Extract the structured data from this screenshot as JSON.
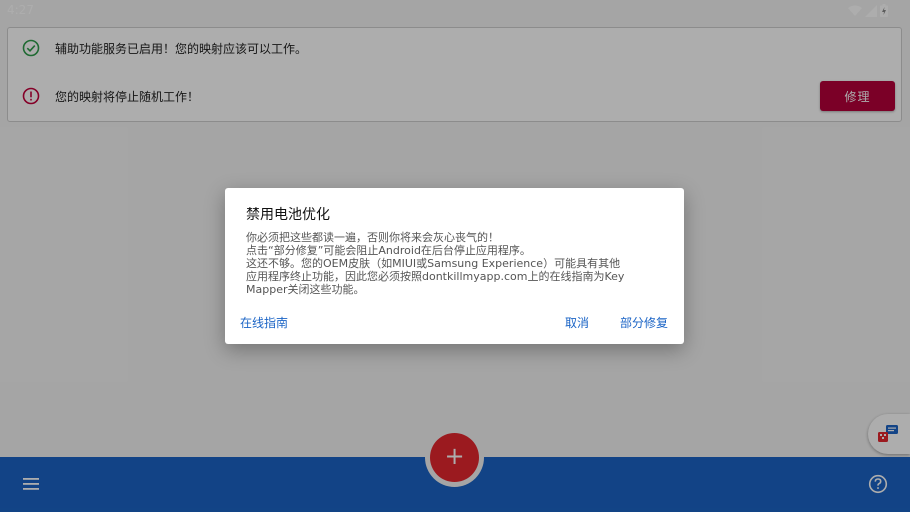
{
  "status_bar": {
    "time": "4:27",
    "icons": [
      "wifi-icon",
      "signal-icon",
      "battery-icon"
    ]
  },
  "status_card": {
    "rows": [
      {
        "icon": "check-circle-icon",
        "text": "辅助功能服务已启用！您的映射应该可以工作。"
      },
      {
        "icon": "alert-circle-icon",
        "text": "您的映射将停止随机工作！"
      }
    ],
    "fix_label": "修理"
  },
  "dialog": {
    "title": "禁用电池优化",
    "body_lines": [
      "你必须把这些都读一遍，否则你将来会灰心丧气的！",
      "点击“部分修复”可能会阻止Android在后台停止应用程序。",
      "这还不够。您的OEM皮肤（如MIUI或Samsung Experience）可能具有其他",
      "应用程序终止功能，因此您必须按照dontkillmyapp.com上的在线指南为Key",
      "Mapper关闭这些功能。"
    ],
    "guide_label": "在线指南",
    "cancel_label": "取消",
    "partial_fix_label": "部分修复"
  },
  "bottom_bar": {
    "fab_symbol": "+",
    "icons": [
      "menu-icon",
      "help-icon"
    ]
  },
  "colors": {
    "primary": "#1b64c6",
    "accent_fab": "#e5272f",
    "fix_button": "#b5003a",
    "check": "#2e9c4a",
    "alert": "#c4003b"
  }
}
